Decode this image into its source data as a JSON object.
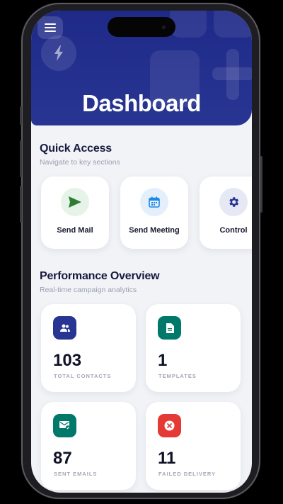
{
  "header": {
    "title": "Dashboard",
    "menu_icon": "hamburger-menu-icon",
    "badge_icon": "lightning-bolt-icon",
    "color": "#283593"
  },
  "quick_access": {
    "title": "Quick Access",
    "subtitle": "Navigate to key sections",
    "items": [
      {
        "label": "Send Mail",
        "icon": "send-icon",
        "icon_color": "#2e7d32",
        "bg": "#e6f3e8"
      },
      {
        "label": "Send Meeting",
        "icon": "calendar-icon",
        "icon_color": "#1e88e5",
        "bg": "#e3f0fb"
      },
      {
        "label": "Control",
        "icon": "gear-icon",
        "icon_color": "#283593",
        "bg": "#e6e8f4"
      }
    ]
  },
  "performance": {
    "title": "Performance Overview",
    "subtitle": "Real-time campaign analytics",
    "stats": [
      {
        "value": "103",
        "label": "TOTAL CONTACTS",
        "icon": "contacts-icon",
        "color": "#283593"
      },
      {
        "value": "1",
        "label": "TEMPLATES",
        "icon": "document-icon",
        "color": "#00796b"
      },
      {
        "value": "87",
        "label": "SENT EMAILS",
        "icon": "mail-check-icon",
        "color": "#00796b"
      },
      {
        "value": "11",
        "label": "FAILED DELIVERY",
        "icon": "error-icon",
        "color": "#e53935"
      }
    ]
  }
}
